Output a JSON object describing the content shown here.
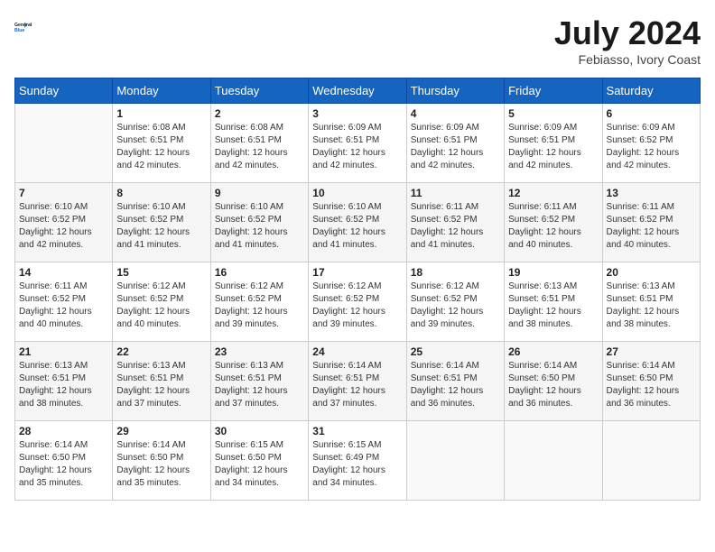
{
  "header": {
    "logo_line1": "General",
    "logo_line2": "Blue",
    "month_title": "July 2024",
    "location": "Febiasso, Ivory Coast"
  },
  "days_of_week": [
    "Sunday",
    "Monday",
    "Tuesday",
    "Wednesday",
    "Thursday",
    "Friday",
    "Saturday"
  ],
  "weeks": [
    [
      {
        "day": "",
        "sunrise": "",
        "sunset": "",
        "daylight": ""
      },
      {
        "day": "1",
        "sunrise": "Sunrise: 6:08 AM",
        "sunset": "Sunset: 6:51 PM",
        "daylight": "Daylight: 12 hours and 42 minutes."
      },
      {
        "day": "2",
        "sunrise": "Sunrise: 6:08 AM",
        "sunset": "Sunset: 6:51 PM",
        "daylight": "Daylight: 12 hours and 42 minutes."
      },
      {
        "day": "3",
        "sunrise": "Sunrise: 6:09 AM",
        "sunset": "Sunset: 6:51 PM",
        "daylight": "Daylight: 12 hours and 42 minutes."
      },
      {
        "day": "4",
        "sunrise": "Sunrise: 6:09 AM",
        "sunset": "Sunset: 6:51 PM",
        "daylight": "Daylight: 12 hours and 42 minutes."
      },
      {
        "day": "5",
        "sunrise": "Sunrise: 6:09 AM",
        "sunset": "Sunset: 6:51 PM",
        "daylight": "Daylight: 12 hours and 42 minutes."
      },
      {
        "day": "6",
        "sunrise": "Sunrise: 6:09 AM",
        "sunset": "Sunset: 6:52 PM",
        "daylight": "Daylight: 12 hours and 42 minutes."
      }
    ],
    [
      {
        "day": "7",
        "sunrise": "Sunrise: 6:10 AM",
        "sunset": "Sunset: 6:52 PM",
        "daylight": "Daylight: 12 hours and 42 minutes."
      },
      {
        "day": "8",
        "sunrise": "Sunrise: 6:10 AM",
        "sunset": "Sunset: 6:52 PM",
        "daylight": "Daylight: 12 hours and 41 minutes."
      },
      {
        "day": "9",
        "sunrise": "Sunrise: 6:10 AM",
        "sunset": "Sunset: 6:52 PM",
        "daylight": "Daylight: 12 hours and 41 minutes."
      },
      {
        "day": "10",
        "sunrise": "Sunrise: 6:10 AM",
        "sunset": "Sunset: 6:52 PM",
        "daylight": "Daylight: 12 hours and 41 minutes."
      },
      {
        "day": "11",
        "sunrise": "Sunrise: 6:11 AM",
        "sunset": "Sunset: 6:52 PM",
        "daylight": "Daylight: 12 hours and 41 minutes."
      },
      {
        "day": "12",
        "sunrise": "Sunrise: 6:11 AM",
        "sunset": "Sunset: 6:52 PM",
        "daylight": "Daylight: 12 hours and 40 minutes."
      },
      {
        "day": "13",
        "sunrise": "Sunrise: 6:11 AM",
        "sunset": "Sunset: 6:52 PM",
        "daylight": "Daylight: 12 hours and 40 minutes."
      }
    ],
    [
      {
        "day": "14",
        "sunrise": "Sunrise: 6:11 AM",
        "sunset": "Sunset: 6:52 PM",
        "daylight": "Daylight: 12 hours and 40 minutes."
      },
      {
        "day": "15",
        "sunrise": "Sunrise: 6:12 AM",
        "sunset": "Sunset: 6:52 PM",
        "daylight": "Daylight: 12 hours and 40 minutes."
      },
      {
        "day": "16",
        "sunrise": "Sunrise: 6:12 AM",
        "sunset": "Sunset: 6:52 PM",
        "daylight": "Daylight: 12 hours and 39 minutes."
      },
      {
        "day": "17",
        "sunrise": "Sunrise: 6:12 AM",
        "sunset": "Sunset: 6:52 PM",
        "daylight": "Daylight: 12 hours and 39 minutes."
      },
      {
        "day": "18",
        "sunrise": "Sunrise: 6:12 AM",
        "sunset": "Sunset: 6:52 PM",
        "daylight": "Daylight: 12 hours and 39 minutes."
      },
      {
        "day": "19",
        "sunrise": "Sunrise: 6:13 AM",
        "sunset": "Sunset: 6:51 PM",
        "daylight": "Daylight: 12 hours and 38 minutes."
      },
      {
        "day": "20",
        "sunrise": "Sunrise: 6:13 AM",
        "sunset": "Sunset: 6:51 PM",
        "daylight": "Daylight: 12 hours and 38 minutes."
      }
    ],
    [
      {
        "day": "21",
        "sunrise": "Sunrise: 6:13 AM",
        "sunset": "Sunset: 6:51 PM",
        "daylight": "Daylight: 12 hours and 38 minutes."
      },
      {
        "day": "22",
        "sunrise": "Sunrise: 6:13 AM",
        "sunset": "Sunset: 6:51 PM",
        "daylight": "Daylight: 12 hours and 37 minutes."
      },
      {
        "day": "23",
        "sunrise": "Sunrise: 6:13 AM",
        "sunset": "Sunset: 6:51 PM",
        "daylight": "Daylight: 12 hours and 37 minutes."
      },
      {
        "day": "24",
        "sunrise": "Sunrise: 6:14 AM",
        "sunset": "Sunset: 6:51 PM",
        "daylight": "Daylight: 12 hours and 37 minutes."
      },
      {
        "day": "25",
        "sunrise": "Sunrise: 6:14 AM",
        "sunset": "Sunset: 6:51 PM",
        "daylight": "Daylight: 12 hours and 36 minutes."
      },
      {
        "day": "26",
        "sunrise": "Sunrise: 6:14 AM",
        "sunset": "Sunset: 6:50 PM",
        "daylight": "Daylight: 12 hours and 36 minutes."
      },
      {
        "day": "27",
        "sunrise": "Sunrise: 6:14 AM",
        "sunset": "Sunset: 6:50 PM",
        "daylight": "Daylight: 12 hours and 36 minutes."
      }
    ],
    [
      {
        "day": "28",
        "sunrise": "Sunrise: 6:14 AM",
        "sunset": "Sunset: 6:50 PM",
        "daylight": "Daylight: 12 hours and 35 minutes."
      },
      {
        "day": "29",
        "sunrise": "Sunrise: 6:14 AM",
        "sunset": "Sunset: 6:50 PM",
        "daylight": "Daylight: 12 hours and 35 minutes."
      },
      {
        "day": "30",
        "sunrise": "Sunrise: 6:15 AM",
        "sunset": "Sunset: 6:50 PM",
        "daylight": "Daylight: 12 hours and 34 minutes."
      },
      {
        "day": "31",
        "sunrise": "Sunrise: 6:15 AM",
        "sunset": "Sunset: 6:49 PM",
        "daylight": "Daylight: 12 hours and 34 minutes."
      },
      {
        "day": "",
        "sunrise": "",
        "sunset": "",
        "daylight": ""
      },
      {
        "day": "",
        "sunrise": "",
        "sunset": "",
        "daylight": ""
      },
      {
        "day": "",
        "sunrise": "",
        "sunset": "",
        "daylight": ""
      }
    ]
  ]
}
